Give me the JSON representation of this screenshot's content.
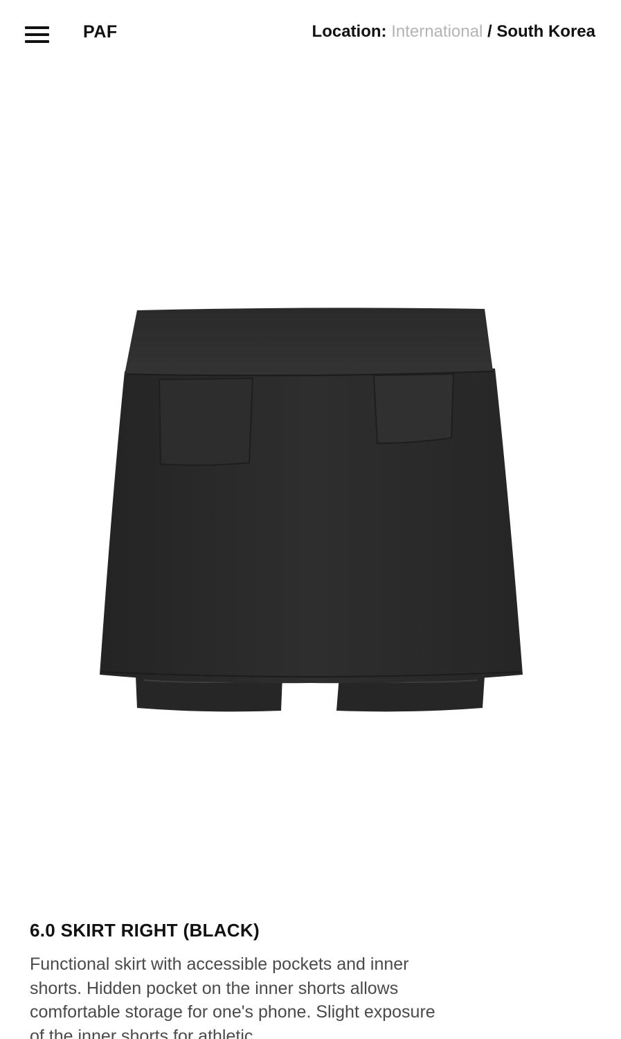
{
  "header": {
    "brand": "PAF",
    "menu_icon": "hamburger-menu-icon",
    "location_label": "Location:",
    "location_international": "International",
    "location_separator": "/",
    "location_current": "South Korea"
  },
  "product": {
    "image_alt": "black skirt with inner shorts",
    "title": "6.0 SKIRT RIGHT (BLACK)",
    "description": "Functional skirt with accessible pockets and inner shorts. Hidden pocket on the inner shorts allows comfortable storage for one's phone. Slight exposure of the inner shorts for athletic"
  },
  "colors": {
    "text": "#111111",
    "muted_link": "#b4b4b4",
    "description": "#4a4a4a",
    "garment": "#2a2a2a"
  }
}
